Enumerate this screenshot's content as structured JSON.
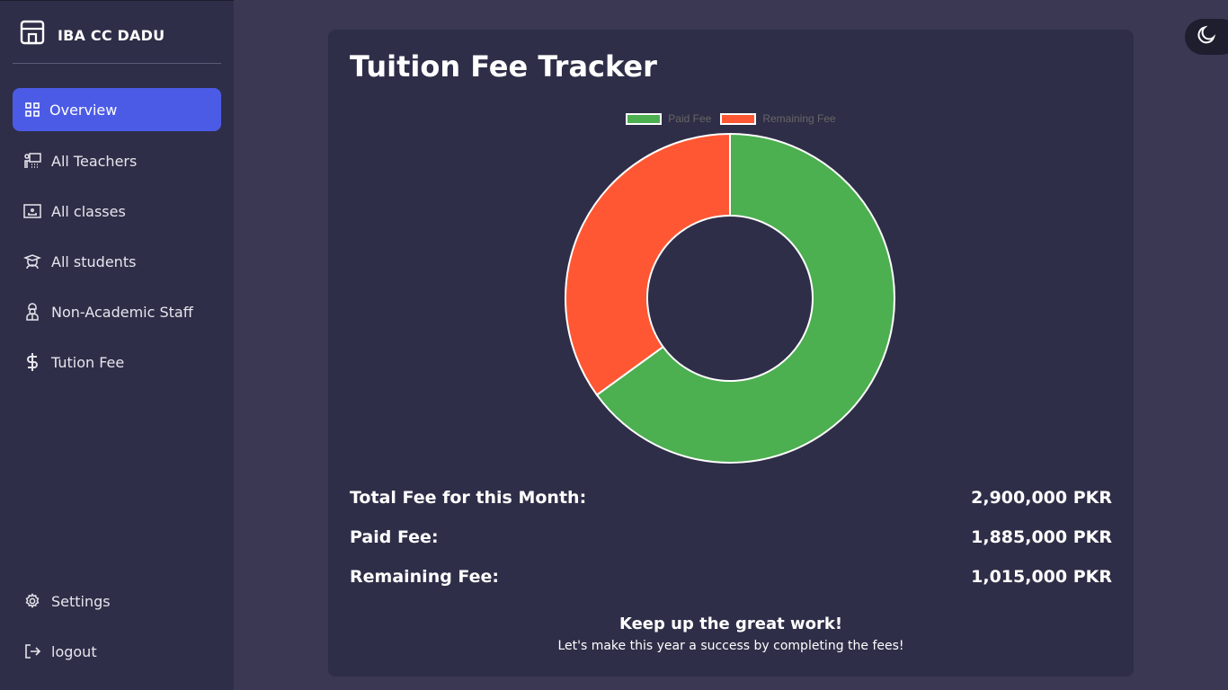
{
  "brand": {
    "name": "IBA CC DADU"
  },
  "sidebar": {
    "items": [
      {
        "label": "Overview",
        "icon": "grid-icon",
        "active": true
      },
      {
        "label": "All Teachers",
        "icon": "teacher-icon"
      },
      {
        "label": "All classes",
        "icon": "classroom-icon"
      },
      {
        "label": "All students",
        "icon": "student-icon"
      },
      {
        "label": "Non-Academic Staff",
        "icon": "staff-icon"
      },
      {
        "label": "Tution Fee",
        "icon": "dollar-icon"
      }
    ],
    "bottom": [
      {
        "label": "Settings",
        "icon": "gear-icon"
      },
      {
        "label": "logout",
        "icon": "logout-icon"
      }
    ]
  },
  "theme_toggle": {
    "icon": "moon-icon"
  },
  "card": {
    "title": "Tuition Fee Tracker",
    "rows": [
      {
        "label": "Total Fee for this Month:",
        "value": "2,900,000 PKR"
      },
      {
        "label": "Paid Fee:",
        "value": "1,885,000 PKR"
      },
      {
        "label": "Remaining Fee:",
        "value": "1,015,000 PKR"
      }
    ],
    "footer_title": "Keep up the great work!",
    "footer_sub": "Let's make this year a success by completing the fees!"
  },
  "chart_data": {
    "type": "pie",
    "style": "doughnut",
    "categories": [
      "Paid Fee",
      "Remaining Fee"
    ],
    "values": [
      1885000,
      1015000
    ],
    "colors": [
      "#4caf50",
      "#ff5733"
    ],
    "legend": "top"
  },
  "colors": {
    "accent": "#4c5be6",
    "sidebar_bg": "#2f2e48",
    "page_bg": "#3a3853"
  }
}
